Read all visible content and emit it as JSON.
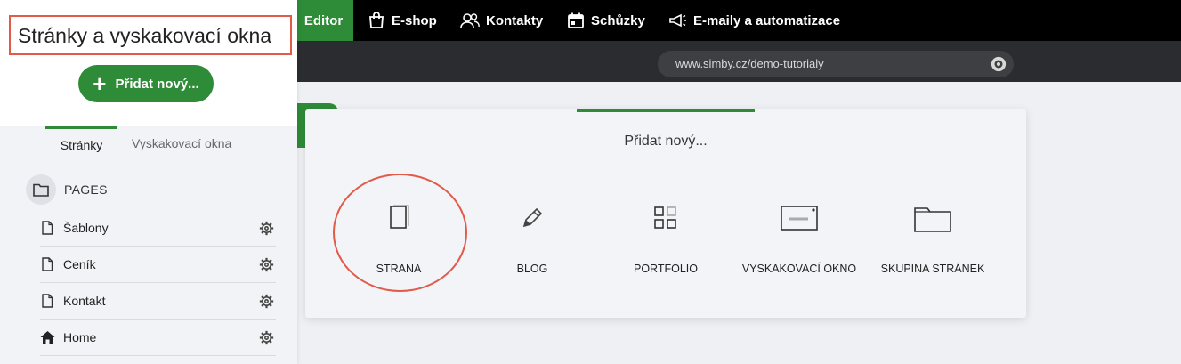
{
  "topnav": {
    "items": [
      {
        "label": "Editor",
        "icon": "editor"
      },
      {
        "label": "E-shop",
        "icon": "shopping-bag-icon"
      },
      {
        "label": "Kontakty",
        "icon": "contacts-icon"
      },
      {
        "label": "Schůzky",
        "icon": "calendar-icon"
      },
      {
        "label": "E-maily a automatizace",
        "icon": "megaphone-icon"
      }
    ]
  },
  "urlbar": {
    "url": "www.simby.cz/demo-tutorialy",
    "icon": "gear-icon"
  },
  "sidebar": {
    "title": "Stránky a vyskakovací okna",
    "add_button": "Přidat nový...",
    "tabs": [
      "Stránky",
      "Vyskakovací okna"
    ],
    "section_label": "PAGES",
    "pages": [
      {
        "label": "Šablony",
        "icon": "page-icon"
      },
      {
        "label": "Ceník",
        "icon": "page-icon"
      },
      {
        "label": "Kontakt",
        "icon": "page-icon"
      },
      {
        "label": "Home",
        "icon": "home-icon"
      }
    ]
  },
  "modal": {
    "title": "Přidat nový...",
    "options": [
      {
        "label": "STRANA",
        "icon": "page-icon"
      },
      {
        "label": "BLOG",
        "icon": "pencil-icon"
      },
      {
        "label": "PORTFOLIO",
        "icon": "grid-icon"
      },
      {
        "label": "VYSKAKOVACÍ OKNO",
        "icon": "popup-window-icon"
      },
      {
        "label": "SKUPINA STRÁNEK",
        "icon": "folder-icon"
      }
    ]
  },
  "colors": {
    "accent_green": "#2e8b37",
    "annotation_red": "#e25a48",
    "topbar": "#000000"
  }
}
